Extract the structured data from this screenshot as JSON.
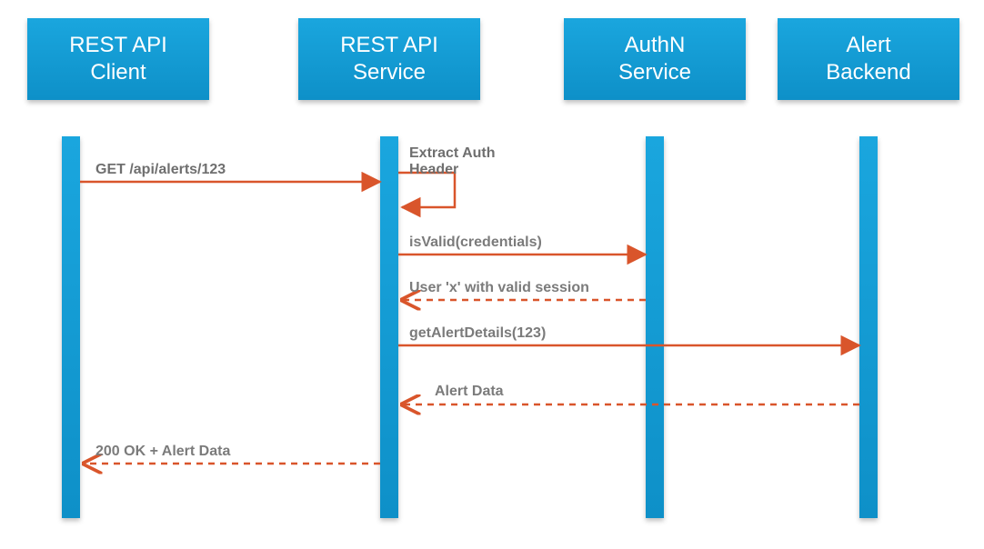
{
  "participants": {
    "client": {
      "label": "REST API\nClient"
    },
    "service": {
      "label": "REST API\nService"
    },
    "authn": {
      "label": "AuthN\nService"
    },
    "backend": {
      "label": "Alert\nBackend"
    }
  },
  "messages": {
    "m1": "GET /api/alerts/123",
    "m2": "Extract Auth\nHeader",
    "m3": "isValid(credentials)",
    "m4": "User 'x' with valid session",
    "m5": "getAlertDetails(123)",
    "m6": "Alert Data",
    "m7": "200 OK + Alert Data"
  },
  "colors": {
    "participant": "#169fd7",
    "arrow": "#d9552b",
    "label": "#7b7b7b"
  }
}
